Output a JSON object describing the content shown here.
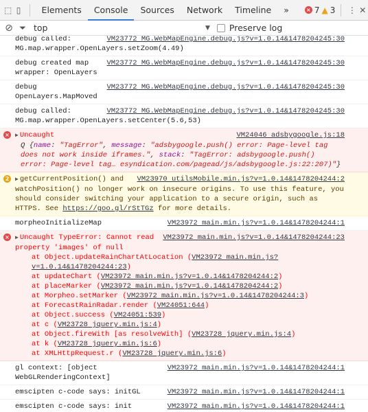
{
  "toolbar": {
    "tabs": [
      "Elements",
      "Console",
      "Sources",
      "Network",
      "Timeline"
    ],
    "active_tab": "Console",
    "more": "»",
    "error_count": "7",
    "warning_count": "3"
  },
  "filter": {
    "context": "top",
    "preserve_log_label": "Preserve log",
    "preserve_log_checked": false
  },
  "log": [
    {
      "text": "debug called: MG.map.wrapper.OpenLayers.setZoom(4.49)",
      "source": "VM23772 MG.WebMapEngine.debug.js?v=1.0.14&1478204245:30"
    },
    {
      "text": "debug created map wrapper: OpenLayers",
      "source": "VM23772 MG.WebMapEngine.debug.js?v=1.0.14&1478204245:30"
    },
    {
      "text": "debug OpenLayers.MapMoved",
      "source": "VM23772 MG.WebMapEngine.debug.js?v=1.0.14&1478204245:30"
    },
    {
      "text": "debug called: MG.map.wrapper.OpenLayers.setCenter(5.6,53)",
      "source": "VM23772 MG.WebMapEngine.debug.js?v=1.0.14&1478204245:30"
    }
  ],
  "error1": {
    "title": "Uncaught",
    "source": "VM24046 adsbygoogle.js:18",
    "obj_prefix": "Q {",
    "k_name": "name",
    "v_name": "\"TagError\"",
    "k_message": "message",
    "v_message": "\"adsbygoogle.push() error: Page-level tag does not work inside iframes.\"",
    "k_stack": "stack",
    "v_stack": "\"TagError: adsbygoogle.push() error: Page-level tag… esyndication.com/pagead/js/adsbygoogle.js:22:207)\"",
    "obj_suffix": "}"
  },
  "warning": {
    "count": "2",
    "text": "getCurrentPosition() and watchPosition() no longer work on insecure origins. To use this feature, you should consider switching your application to a secure origin, such as HTTPS. See",
    "link": "https://goo.gl/rStTGz",
    "text_after": "for more details.",
    "source": "VM23970 utilsMobile.min.js?v=1.0.14&1478204244:2"
  },
  "log2": {
    "text": "morpheoInitializeMap",
    "source": "VM23972 main.min.js?v=1.0.14&1478204244:1"
  },
  "error2": {
    "title": "Uncaught TypeError: Cannot read property 'images' of null",
    "source": "VM23972 main.min.js?v=1.0.14&1478204244:23",
    "stack": [
      {
        "fn": "at Object.updateRainChartAtLocation",
        "loc": "VM23972 main.min.js?v=1.0.14&1478204244:23"
      },
      {
        "fn": "at updateChart",
        "loc": "VM23972 main.min.js?v=1.0.14&1478204244:2"
      },
      {
        "fn": "at placeMarker",
        "loc": "VM23972 main.min.js?v=1.0.14&1478204244:2"
      },
      {
        "fn": "at Morpheo.setMarker",
        "loc": "VM23972 main.min.js?v=1.0.14&1478204244:3"
      },
      {
        "fn": "at ForecastRainRadar.render",
        "loc": "VM24051:644"
      },
      {
        "fn": "at Object.success",
        "loc": "VM24051:539"
      },
      {
        "fn": "at c",
        "loc": "VM23728 jquery.min.js:4"
      },
      {
        "fn": "at Object.fireWith [as resolveWith]",
        "loc": "VM23728 jquery.min.js:4"
      },
      {
        "fn": "at k",
        "loc": "VM23728 jquery.min.js:6"
      },
      {
        "fn": "at XMLHttpRequest.r",
        "loc": "VM23728 jquery.min.js:6"
      }
    ]
  },
  "log3": [
    {
      "text": "gl context: [object WebGLRenderingContext]",
      "source": "VM23972 main.min.js?v=1.0.14&1478204244:1"
    },
    {
      "text": "emscipten c-code says: initGL",
      "source": "VM23972 main.min.js?v=1.0.14&1478204244:1"
    },
    {
      "text": "emscipten c-code says: init",
      "source": "VM23972 main.min.js?v=1.0.14&1478204244:1"
    }
  ]
}
